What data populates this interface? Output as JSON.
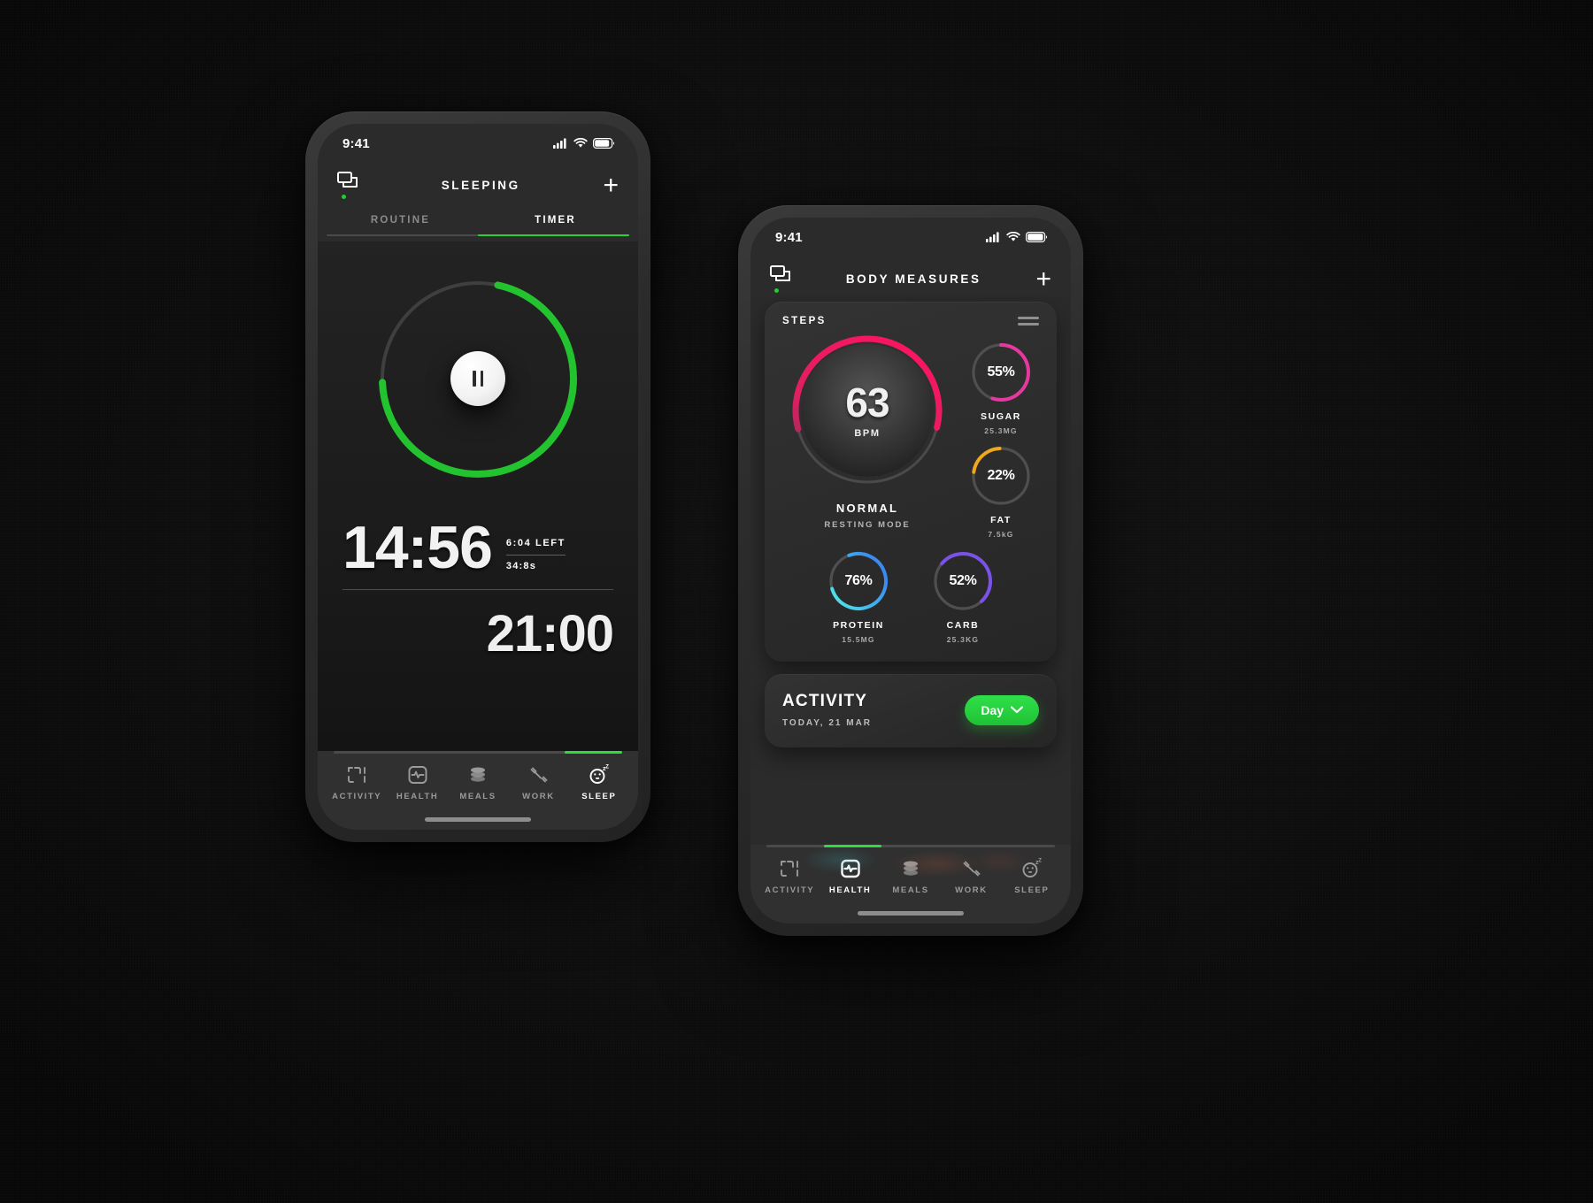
{
  "phone1": {
    "status": {
      "time": "9:41",
      "icons": [
        "cellular-icon",
        "wifi-icon",
        "battery-icon"
      ]
    },
    "header": {
      "title": "SLEEPING",
      "message_icon": "message-icon",
      "add_icon": "plus-icon"
    },
    "tabs": [
      {
        "label": "ROUTINE",
        "active": false
      },
      {
        "label": "TIMER",
        "active": true
      }
    ],
    "timer": {
      "progress_pct": 71,
      "ring_color": "#22c32e",
      "track_color": "#3f3f3f",
      "pause_icon": "pause-icon",
      "elapsed": "14:56",
      "left_label": "6:04 LEFT",
      "total_label": "34:8s",
      "target_time": "21:00"
    },
    "tabbar": {
      "items": [
        {
          "label": "ACTIVITY",
          "icon": "activity-icon",
          "active": false
        },
        {
          "label": "HEALTH",
          "icon": "health-icon",
          "active": false
        },
        {
          "label": "MEALS",
          "icon": "meals-icon",
          "active": false
        },
        {
          "label": "WORK",
          "icon": "work-icon",
          "active": false
        },
        {
          "label": "SLEEP",
          "icon": "sleep-icon",
          "active": true
        }
      ],
      "active_index": 4
    }
  },
  "phone2": {
    "status": {
      "time": "9:41",
      "icons": [
        "cellular-icon",
        "wifi-icon",
        "battery-icon"
      ]
    },
    "header": {
      "title": "BODY MEASURES",
      "message_icon": "message-icon",
      "add_icon": "plus-icon"
    },
    "steps_card": {
      "title": "STEPS",
      "menu_icon": "menu-icon",
      "heart_rate": {
        "value": "63",
        "unit": "BPM",
        "state": "NORMAL",
        "mode": "RESTING MODE",
        "progress_pct": 58,
        "color": "#e81d62"
      },
      "metrics": [
        {
          "name": "SUGAR",
          "percent": "55%",
          "value": "25.3MG",
          "pct": 55,
          "color": "#e5399f"
        },
        {
          "name": "FAT",
          "percent": "22%",
          "value": "7.5kG",
          "pct": 22,
          "color": "#f0a81c"
        },
        {
          "name": "PROTEIN",
          "percent": "76%",
          "value": "15.5MG",
          "pct": 76,
          "color": "#3fc9e0"
        },
        {
          "name": "CARB",
          "percent": "52%",
          "value": "25.3KG",
          "pct": 52,
          "color": "#7b52e8"
        }
      ]
    },
    "activity_card": {
      "title": "ACTIVITY",
      "subtitle": "TODAY, 21 MAR",
      "range_button": {
        "label": "Day",
        "icon": "chevron-down-icon",
        "color": "#24d13b"
      }
    },
    "tabbar": {
      "items": [
        {
          "label": "ACTIVITY",
          "icon": "activity-icon",
          "active": false
        },
        {
          "label": "HEALTH",
          "icon": "health-icon",
          "active": true
        },
        {
          "label": "MEALS",
          "icon": "meals-icon",
          "active": false
        },
        {
          "label": "WORK",
          "icon": "work-icon",
          "active": false
        },
        {
          "label": "SLEEP",
          "icon": "sleep-icon",
          "active": false
        }
      ],
      "active_index": 1
    }
  }
}
